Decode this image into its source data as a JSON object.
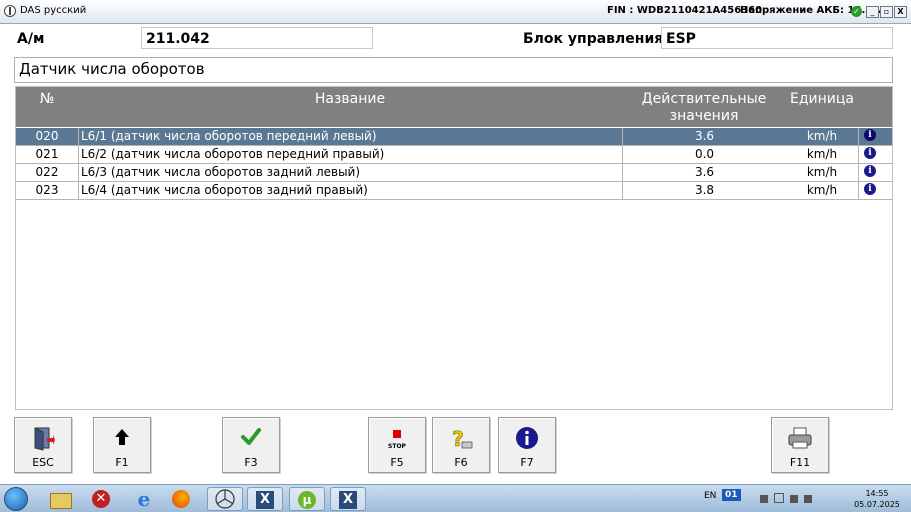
{
  "window": {
    "title": "DAS русский",
    "fin_text": "FIN : WDB2110421A456360",
    "battery_text": "Напряжение АКБ: 13.8 V",
    "controls": [
      "_",
      "▫",
      "X"
    ]
  },
  "header": {
    "vehicle_label": "А/м",
    "vehicle_value": "211.042",
    "ecu_label": "Блок управления",
    "ecu_value": "ESP"
  },
  "section_title": "Датчик числа оборотов",
  "table": {
    "columns": [
      "№",
      "Название",
      "Действительные значения",
      "Единица"
    ],
    "rows": [
      {
        "num": "020",
        "name": "L6/1 (датчик числа оборотов передний левый)",
        "value": "3.6",
        "unit": "km/h",
        "selected": true
      },
      {
        "num": "021",
        "name": "L6/2 (датчик числа оборотов передний правый)",
        "value": "0.0",
        "unit": "km/h",
        "selected": false
      },
      {
        "num": "022",
        "name": "L6/3 (датчик числа оборотов задний левый)",
        "value": "3.6",
        "unit": "km/h",
        "selected": false
      },
      {
        "num": "023",
        "name": "L6/4 (датчик числа оборотов задний правый)",
        "value": "3.8",
        "unit": "km/h",
        "selected": false
      }
    ],
    "info_glyph": "i"
  },
  "fkeys": {
    "esc": {
      "label": "ESC",
      "icon": "exit-door-icon"
    },
    "f1": {
      "label": "F1",
      "icon": "arrow-up-icon"
    },
    "f3": {
      "label": "F3",
      "icon": "checkmark-icon"
    },
    "f5": {
      "label": "F5",
      "icon": "stop-icon",
      "icon_text": "STOP"
    },
    "f6": {
      "label": "F6",
      "icon": "help-icon"
    },
    "f7": {
      "label": "F7",
      "icon": "info-icon"
    },
    "f11": {
      "label": "F11",
      "icon": "printer-icon"
    }
  },
  "taskbar": {
    "apps": [
      "explorer-icon",
      "app-red-x-icon",
      "internet-explorer-icon",
      "firefox-icon",
      "mercedes-star-icon",
      "xentry-icon",
      "utorrent-icon",
      "xentry-icon"
    ],
    "lang": "EN",
    "tray_badge": "01",
    "time": "14:55",
    "date": "05.07.2025"
  },
  "colors": {
    "selected_row": "#5a7894",
    "header_bg": "#808080",
    "info_icon": "#1a1a8c",
    "check": "#2a9a2a",
    "stop": "#e00000"
  }
}
